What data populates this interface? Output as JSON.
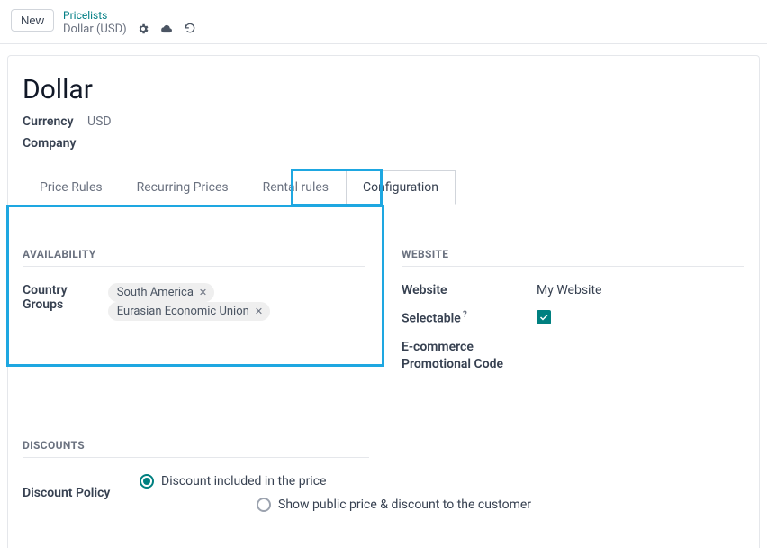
{
  "topbar": {
    "new_label": "New",
    "breadcrumb_parent": "Pricelists",
    "breadcrumb_current": "Dollar (USD)"
  },
  "record": {
    "title": "Dollar",
    "currency_label": "Currency",
    "currency_value": "USD",
    "company_label": "Company",
    "company_value": ""
  },
  "tabs": [
    {
      "label": "Price Rules"
    },
    {
      "label": "Recurring Prices"
    },
    {
      "label": "Rental rules"
    },
    {
      "label": "Configuration"
    }
  ],
  "availability": {
    "heading": "AVAILABILITY",
    "country_groups_label": "Country Groups",
    "country_groups": [
      "South America",
      "Eurasian Economic Union"
    ]
  },
  "website": {
    "heading": "WEBSITE",
    "website_label": "Website",
    "website_value": "My Website",
    "selectable_label": "Selectable",
    "selectable_help": "?",
    "selectable_checked": true,
    "promo_label_line1": "E-commerce",
    "promo_label_line2": "Promotional Code"
  },
  "discounts": {
    "heading": "DISCOUNTS",
    "policy_label": "Discount Policy",
    "options": [
      "Discount included in the price",
      "Show public price & discount to the customer"
    ]
  }
}
